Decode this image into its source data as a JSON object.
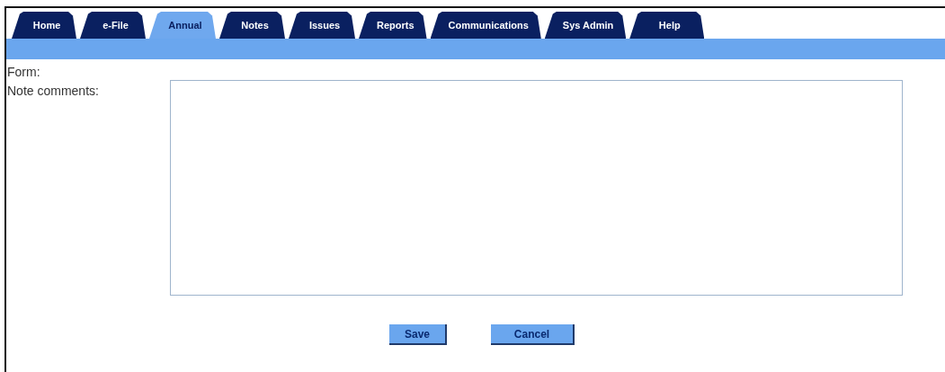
{
  "tabs": [
    {
      "label": "Home",
      "selected": false
    },
    {
      "label": "e-File",
      "selected": false
    },
    {
      "label": "Annual",
      "selected": true
    },
    {
      "label": "Notes",
      "selected": false
    },
    {
      "label": "Issues",
      "selected": false
    },
    {
      "label": "Reports",
      "selected": false
    },
    {
      "label": "Communications",
      "selected": false
    },
    {
      "label": "Sys Admin",
      "selected": false
    },
    {
      "label": "Help",
      "selected": false
    }
  ],
  "form": {
    "form_label": "Form:",
    "comments_label": "Note comments:"
  },
  "buttons": [
    {
      "label": "Save"
    },
    {
      "label": "Cancel"
    }
  ]
}
